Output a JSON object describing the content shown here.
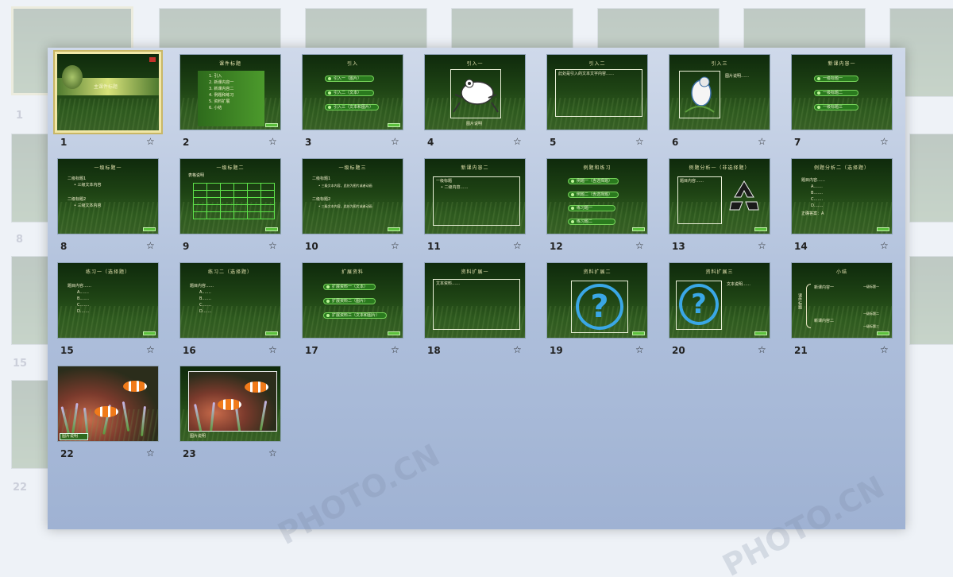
{
  "backdrop": {
    "numbers": [
      "1",
      "8",
      "15",
      "22"
    ]
  },
  "slides": [
    {
      "num": "1",
      "title": "主课件标题",
      "selected": true
    },
    {
      "num": "2",
      "title": "课件标题",
      "items": [
        "1.  引入",
        "2.  新课内容一",
        "3.  新课内容二",
        "4.  例题和练习",
        "5.  资料扩展",
        "6.  小结"
      ]
    },
    {
      "num": "3",
      "title": "引入",
      "pills": [
        "引入一（图片）",
        "引入二（文本）",
        "引入三（文本和图片）"
      ]
    },
    {
      "num": "4",
      "title": "引入一",
      "caption": "图片说明"
    },
    {
      "num": "5",
      "title": "引入二",
      "text": "此处是引入的文本文字内容……"
    },
    {
      "num": "6",
      "title": "引入三",
      "text": "图片说明……"
    },
    {
      "num": "7",
      "title": "新课内容一",
      "pills": [
        "一级标题一",
        "一级标题二",
        "一级标题三"
      ]
    },
    {
      "num": "8",
      "title": "一级标题一",
      "lines": [
        "二级标题1",
        "• 三级文本内容",
        "二级标题2",
        "• 三级文本内容"
      ]
    },
    {
      "num": "9",
      "title": "一级标题二",
      "text": "表格说明"
    },
    {
      "num": "10",
      "title": "一级标题三",
      "lines": [
        "二级标题1",
        "• 三级文本内容，此处为图片或者动画",
        "二级标题2",
        "• 三级文本内容，此处为图片或者动画"
      ]
    },
    {
      "num": "11",
      "title": "新课内容二",
      "lines": [
        "一级标题",
        "• 二级内容……"
      ]
    },
    {
      "num": "12",
      "title": "例题和练习",
      "pills": [
        "例题一（含选择题）",
        "例题二（含选择题）",
        "练习题一",
        "练习题二"
      ]
    },
    {
      "num": "13",
      "title": "例题分析一（非选择题）",
      "text": "题目内容……"
    },
    {
      "num": "14",
      "title": "例题分析二（选择题）",
      "lines": [
        "题目内容……",
        "A.……",
        "B.……",
        "C.……",
        "D.……",
        "正确答案：A"
      ]
    },
    {
      "num": "15",
      "title": "练习一（选择题）",
      "lines": [
        "题目内容……",
        "A.……",
        "B.……",
        "C.……",
        "D.……"
      ]
    },
    {
      "num": "16",
      "title": "练习二（选择题）",
      "lines": [
        "题目内容……",
        "A.……",
        "B.……",
        "C.……",
        "D.……"
      ]
    },
    {
      "num": "17",
      "title": "扩展资料",
      "pills": [
        "扩展资料一（文本）",
        "扩展资料二（图片）",
        "扩展资料三（文本和图片）"
      ]
    },
    {
      "num": "18",
      "title": "资料扩展一",
      "text": "文本资料……"
    },
    {
      "num": "19",
      "title": "资料扩展二"
    },
    {
      "num": "20",
      "title": "资料扩展三",
      "text": "文本说明……"
    },
    {
      "num": "21",
      "title": "小结",
      "lines": [
        "课件标题",
        "新课内容一",
        "新课内容二",
        "一级标题一",
        "一级标题二",
        "一级标题三"
      ]
    },
    {
      "num": "22",
      "caption": "图片说明"
    },
    {
      "num": "23",
      "caption": "图片说明"
    }
  ],
  "icons": {
    "transition": "star-icon"
  },
  "watermark": "PHOTO.CN"
}
